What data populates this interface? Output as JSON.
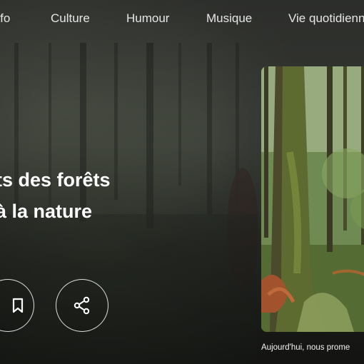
{
  "nav": {
    "items": [
      {
        "label": "Info"
      },
      {
        "label": "Culture"
      },
      {
        "label": "Humour"
      },
      {
        "label": "Musique"
      },
      {
        "label": "Vie quotidienne"
      }
    ]
  },
  "hero": {
    "title_line1": "ts des forêts",
    "title_line2": "à la nature"
  },
  "actions": {
    "bookmark_icon": "bookmark-icon",
    "share_icon": "share-icon"
  },
  "feature_card": {
    "caption": "Aujourd'hui, nous prome"
  }
}
